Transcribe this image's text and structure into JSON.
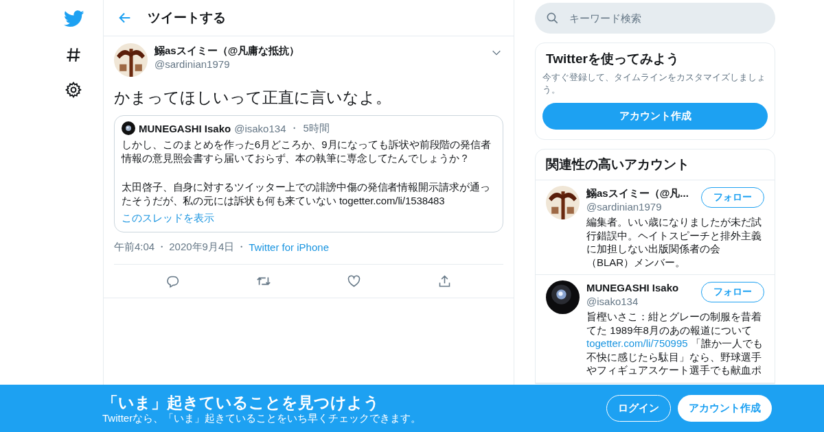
{
  "nav": [
    {
      "kind": "logo"
    },
    {
      "kind": "hash"
    },
    {
      "kind": "settings"
    }
  ],
  "header": {
    "title": "ツイートする"
  },
  "tweet": {
    "author": {
      "name": "鰯asスイミー（@凡庸な抵抗）",
      "handle": "@sardinian1979"
    },
    "text": "かまってほしいって正直に言いなよ。",
    "quote": {
      "name": "MUNEGASHI Isako",
      "handle": "@isako134",
      "separator": "・",
      "time": "5時間",
      "paragraphs": [
        "しかし、このまとめを作った6月どころか、9月になっても訴状や前段階の発信者情報の意見照会書すら届いておらず、本の執筆に専念してたんでしょうか？",
        "太田啓子、自身に対するツイッター上での誹謗中傷の発信者情報開示請求が通ったそうだが、私の元には訴状も何も来ていない togetter.com/li/1538483"
      ],
      "thread_link": "このスレッドを表示"
    },
    "meta": [
      {
        "kind": "text",
        "text": "午前4:04"
      },
      {
        "kind": "sep",
        "text": "・"
      },
      {
        "kind": "text",
        "text": "2020年9月4日"
      },
      {
        "kind": "sep",
        "text": "・"
      },
      {
        "kind": "link",
        "text": "Twitter for iPhone"
      }
    ],
    "actions": [
      {
        "kind": "reply"
      },
      {
        "kind": "retweet"
      },
      {
        "kind": "like"
      },
      {
        "kind": "share"
      }
    ]
  },
  "search": {
    "placeholder": "キーワード検索"
  },
  "signup_card": {
    "title": "Twitterを使ってみよう",
    "text": "今すぐ登録して、タイムラインをカスタマイズしましょう。",
    "button": "アカウント作成"
  },
  "related": {
    "title": "関連性の高いアカウント",
    "accounts": [
      {
        "name": "鰯asスイミー（@凡...",
        "handle": "@sardinian1979",
        "follow": "フォロー",
        "bio": [
          {
            "kind": "text",
            "text": "編集者。いい歳になりましたが未だ試行錯誤中。ヘイトスピーチと排外主義に加担しない出版関係者の会（BLAR）メンバー。"
          }
        ]
      },
      {
        "name": "MUNEGASHI Isako",
        "handle": "@isako134",
        "follow": "フォロー",
        "bio": [
          {
            "kind": "text",
            "text": "旨樫いさこ：紺とグレーの制服を昔着てた 1989年8月のあの報道について "
          },
          {
            "kind": "link",
            "text": "togetter.com/li/750995"
          },
          {
            "kind": "text",
            "text": " 「誰か一人でも不快に感じたら駄目」なら、野球選手やフィギュアスケート選手でも献血ポ"
          }
        ]
      }
    ]
  },
  "banner": {
    "title": "「いま」起きていることを見つけよう",
    "subtitle": "Twitterなら、「いま」起きていることをいち早くチェックできます。",
    "login": "ログイン",
    "signup": "アカウント作成"
  }
}
